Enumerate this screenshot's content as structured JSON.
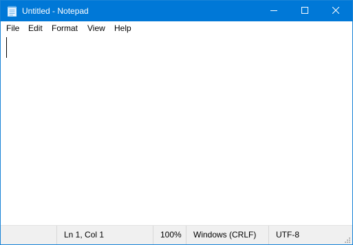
{
  "window": {
    "title": "Untitled - Notepad"
  },
  "titlebar": {
    "app_icon": "notepad-icon",
    "minimize_icon": "minimize-icon",
    "maximize_icon": "maximize-icon",
    "close_icon": "close-icon",
    "accent_color": "#0078d7"
  },
  "menu": {
    "items": [
      {
        "label": "File"
      },
      {
        "label": "Edit"
      },
      {
        "label": "Format"
      },
      {
        "label": "View"
      },
      {
        "label": "Help"
      }
    ]
  },
  "editor": {
    "content": ""
  },
  "status": {
    "position": "Ln 1, Col 1",
    "zoom": "100%",
    "line_ending": "Windows (CRLF)",
    "encoding": "UTF-8"
  }
}
